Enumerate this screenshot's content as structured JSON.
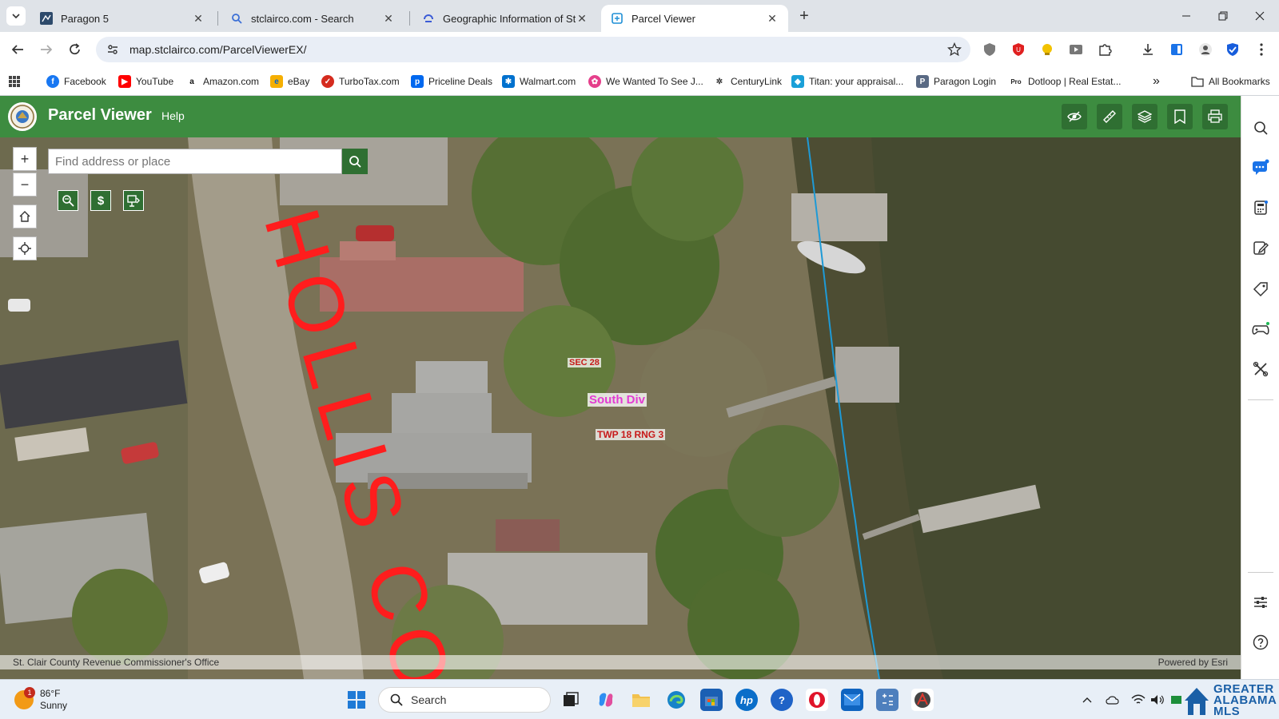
{
  "browser": {
    "tabs": [
      {
        "title": "Paragon 5",
        "active": false
      },
      {
        "title": "stclairco.com - Search",
        "active": false
      },
      {
        "title": "Geographic Information of St. C",
        "active": false
      },
      {
        "title": "Parcel Viewer",
        "active": true
      }
    ],
    "url": "map.stclairco.com/ParcelViewerEX/",
    "bookmarks": [
      {
        "label": "Facebook",
        "icon": "facebook-icon",
        "color": "#1877f2"
      },
      {
        "label": "YouTube",
        "icon": "youtube-icon",
        "color": "#ff0000"
      },
      {
        "label": "Amazon.com",
        "icon": "amazon-icon",
        "color": "#111111"
      },
      {
        "label": "eBay",
        "icon": "ebay-icon",
        "color": "#0064d2"
      },
      {
        "label": "TurboTax.com",
        "icon": "turbotax-icon",
        "color": "#d52b1e"
      },
      {
        "label": "Priceline Deals",
        "icon": "priceline-icon",
        "color": "#0068ef"
      },
      {
        "label": "Walmart.com",
        "icon": "walmart-icon",
        "color": "#0071ce"
      },
      {
        "label": "We Wanted To See J...",
        "icon": "pinwheel-icon",
        "color": "#e53f8b"
      },
      {
        "label": "CenturyLink",
        "icon": "centurylink-icon",
        "color": "#333333"
      },
      {
        "label": "Titan: your appraisal...",
        "icon": "titan-icon",
        "color": "#1aa0d8"
      },
      {
        "label": "Paragon Login",
        "icon": "paragon-icon",
        "color": "#5a6a84"
      },
      {
        "label": "Dotloop | Real Estat...",
        "icon": "dotloop-icon",
        "color": "#222222"
      }
    ],
    "bookmarks_overflow": "»",
    "all_bookmarks": "All Bookmarks"
  },
  "app": {
    "title": "Parcel Viewer",
    "help": "Help",
    "header_color": "#3d8c40",
    "search_placeholder": "Find address or place",
    "zoom_in": "+",
    "zoom_out": "−",
    "tool_chips": [
      "search-map-icon",
      "dollar-icon",
      "sale-icon"
    ],
    "dollar_chip": "$"
  },
  "map": {
    "road_label": "HOLLIS CO",
    "section_label": "SEC 28",
    "subdivision_label": "South Div",
    "township_label": "TWP 18 RNG 3",
    "attribution_left": "St. Clair County Revenue Commissioner's Office",
    "attribution_right": "Powered by Esri"
  },
  "taskbar": {
    "temperature": "86°F",
    "condition": "Sunny",
    "weather_badge": "1",
    "search_label": "Search",
    "brand_line1": "GREATER",
    "brand_line2": "ALABAMA",
    "brand_line3": "MLS"
  }
}
